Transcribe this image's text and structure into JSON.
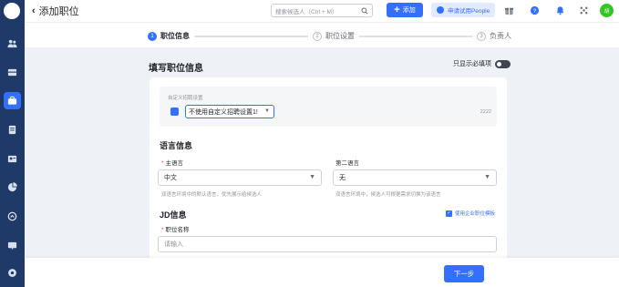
{
  "header": {
    "back_title": "添加职位",
    "search_placeholder": "搜索候选人（Ctrl + M）",
    "add_label": "添加",
    "trial_label": "申请试用People",
    "user_initials": "胡"
  },
  "steps": [
    {
      "num": "1",
      "label": "职位信息",
      "state": "active"
    },
    {
      "num": "2",
      "label": "职位设置",
      "state": "idle"
    },
    {
      "num": "3",
      "label": "负责人",
      "state": "idle"
    }
  ],
  "form": {
    "title": "填写职位信息",
    "required_only_label": "只显示必填项",
    "custom": {
      "label": "自定义招聘设置",
      "select_value": "不使用自定义招聘设置1!",
      "count": "2222"
    },
    "language": {
      "section_title": "语言信息",
      "primary": {
        "label": "主语言",
        "value": "中文",
        "hint": "双语言环境中的默认语言，优先展示给候选人"
      },
      "secondary": {
        "label": "第二语言",
        "value": "无",
        "hint": "双语言环境中，候选人可根据需求切换为该语言"
      }
    },
    "jd": {
      "section_title": "JD信息",
      "template_label": "使用企业职位模板",
      "name_label": "职位名称",
      "name_placeholder": "请输入"
    }
  },
  "footer": {
    "next_label": "下一步"
  },
  "colors": {
    "accent": "#3370ff",
    "rail": "#1f3a68",
    "required": "#f54a45"
  }
}
